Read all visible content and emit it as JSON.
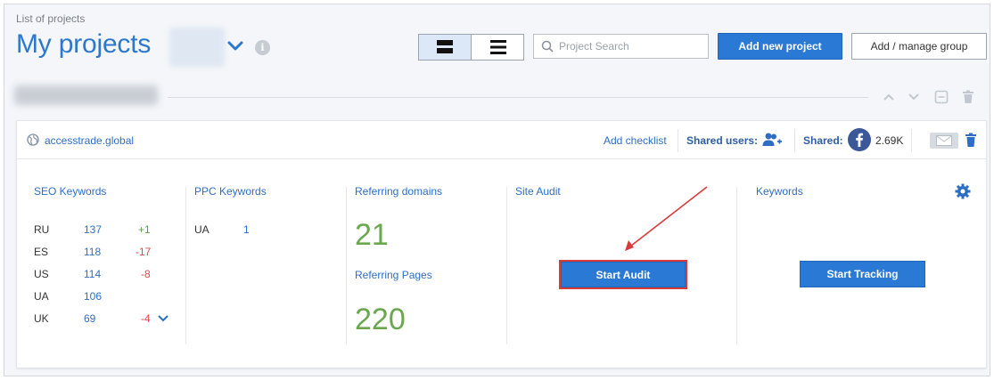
{
  "header": {
    "breadcrumb": "List of projects",
    "title": "My projects"
  },
  "toolbar": {
    "search_placeholder": "Project Search",
    "add_project_label": "Add new project",
    "manage_group_label": "Add / manage group"
  },
  "project": {
    "domain": "accesstrade.global",
    "add_checklist": "Add checklist",
    "shared_users_label": "Shared users:",
    "shared_label": "Shared:",
    "shared_count": "2.69K"
  },
  "seo": {
    "title": "SEO Keywords",
    "rows": [
      {
        "country": "RU",
        "value": "137",
        "change": "+1"
      },
      {
        "country": "ES",
        "value": "118",
        "change": "-17"
      },
      {
        "country": "US",
        "value": "114",
        "change": "-8"
      },
      {
        "country": "UA",
        "value": "106",
        "change": ""
      },
      {
        "country": "UK",
        "value": "69",
        "change": "-4"
      }
    ]
  },
  "ppc": {
    "title": "PPC Keywords",
    "rows": [
      {
        "country": "UA",
        "value": "1"
      }
    ]
  },
  "referring": {
    "domains_title": "Referring domains",
    "domains_value": "21",
    "pages_title": "Referring Pages",
    "pages_value": "220"
  },
  "audit": {
    "title": "Site Audit",
    "button": "Start Audit"
  },
  "keywords": {
    "title": "Keywords",
    "button": "Start Tracking"
  },
  "colors": {
    "accent": "#2a7ad5",
    "positive": "#5aa340",
    "negative": "#e04848",
    "highlight": "#d93a3a"
  },
  "icons": [
    "chevron-down-icon",
    "info-icon",
    "rows-view-icon",
    "list-view-icon",
    "search-icon",
    "chevron-up-icon",
    "collapse-icon",
    "trash-icon",
    "globe-icon",
    "add-user-icon",
    "facebook-icon",
    "mail-icon",
    "gear-icon"
  ]
}
